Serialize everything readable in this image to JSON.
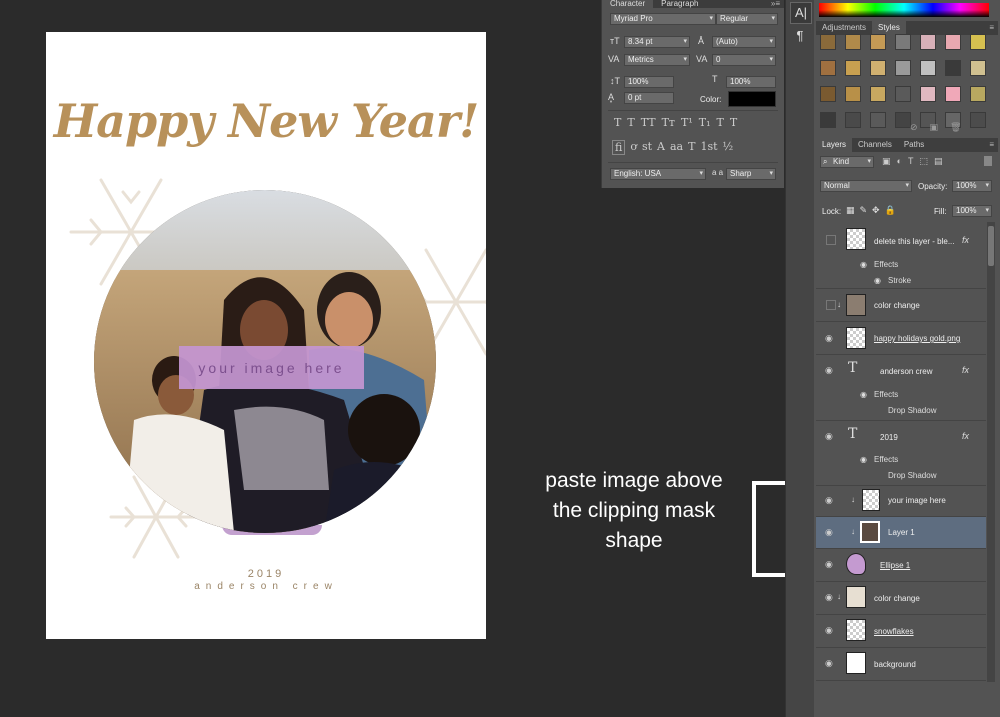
{
  "document": {
    "headline": "Happy New Year!",
    "placeholder": "your image here",
    "year": "2019",
    "crew": "anderson crew"
  },
  "annotation": {
    "lines": [
      "paste image above",
      "the clipping mask",
      "shape"
    ]
  },
  "character_panel": {
    "tabs": [
      "Character",
      "Paragraph"
    ],
    "font_family": "Myriad Pro",
    "font_style": "Regular",
    "font_size": "8.34 pt",
    "leading": "(Auto)",
    "kerning": "Metrics",
    "tracking": "0",
    "vertical_scale": "100%",
    "horizontal_scale": "100%",
    "baseline_shift": "0 pt",
    "color_label": "Color:",
    "text_color": "#000000",
    "style_buttons": [
      "T",
      "T",
      "TT",
      "Tт",
      "T¹",
      "T₁",
      "T",
      "T"
    ],
    "opentype_buttons": [
      "fi",
      "ơ",
      "st",
      "A",
      "aa",
      "T",
      "1st",
      "½"
    ],
    "language": "English: USA",
    "aa_label": "a a",
    "antialias": "Sharp"
  },
  "styles_panel": {
    "tabs": [
      "Adjustments",
      "Styles"
    ],
    "swatches": [
      "#8a6a3a",
      "#b08a4a",
      "#c49a55",
      "#7a7a7a",
      "#d8b0b8",
      "#e8a8b0",
      "#d6c050",
      "#a07040",
      "#c8a050",
      "#d0b070",
      "#9a9a9a",
      "#c0c0c0",
      "#3a3a3a",
      "#d0c090",
      "#7a5a30",
      "#b89048",
      "#c8a860",
      "#5a5a5a",
      "#e0b8c0",
      "#f0a8b8",
      "#b8a860",
      "#3a3a3a",
      "#4a4a4a",
      "#5a5a5a",
      "#444444",
      "#555555",
      "#666666",
      "#4c4c4c"
    ]
  },
  "layers_panel": {
    "tabs": [
      "Layers",
      "Channels",
      "Paths"
    ],
    "filter_kind": "Kind",
    "blend_mode": "Normal",
    "opacity_label": "Opacity:",
    "opacity": "100%",
    "lock_label": "Lock:",
    "fill_label": "Fill:",
    "fill": "100%",
    "layers": [
      {
        "name": "delete this layer - ble...",
        "fx": "fx",
        "effects_label": "Effects",
        "effect": "Stroke"
      },
      {
        "name": "color change"
      },
      {
        "name": "happy holidays gold.png"
      },
      {
        "name": "anderson crew",
        "fx": "fx",
        "effects_label": "Effects",
        "effect": "Drop Shadow"
      },
      {
        "name": "2019",
        "fx": "fx",
        "effects_label": "Effects",
        "effect": "Drop Shadow"
      },
      {
        "name": "your image here"
      },
      {
        "name": "Layer 1"
      },
      {
        "name": "Ellipse 1"
      },
      {
        "name": "color change"
      },
      {
        "name": "snowflakes"
      },
      {
        "name": "background"
      }
    ]
  }
}
